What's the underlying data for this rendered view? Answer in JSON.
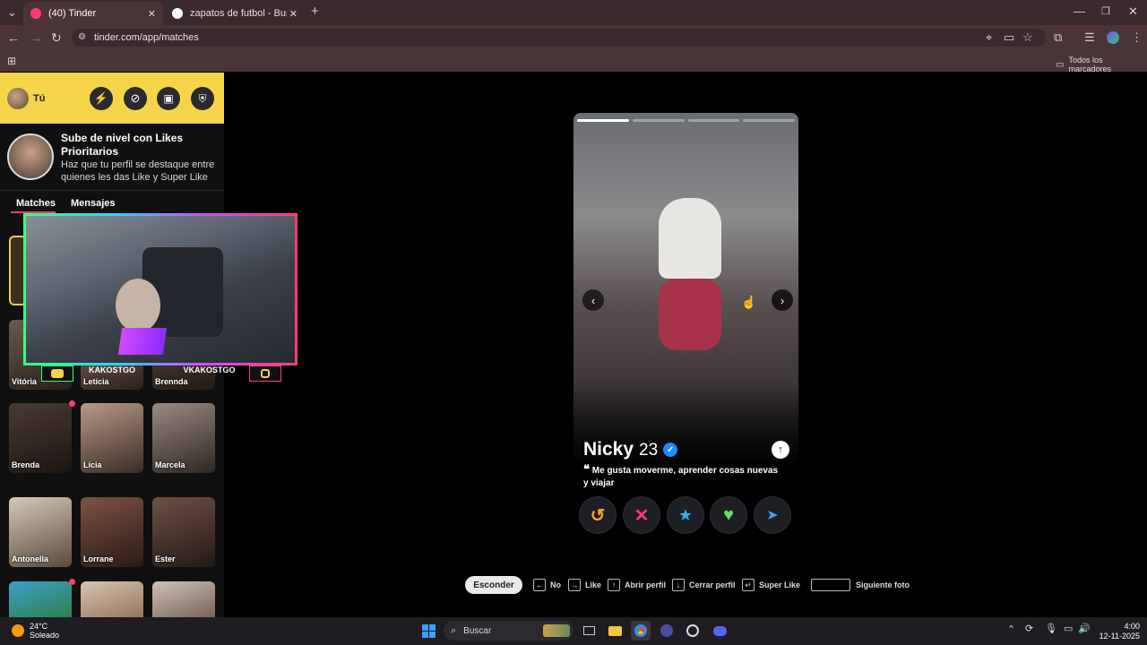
{
  "browser": {
    "tabs": [
      {
        "title": "(40) Tinder",
        "active": true,
        "favicon_color": "#fe3c72"
      },
      {
        "title": "zapatos de futbol - Buscar con",
        "active": false,
        "favicon_color": "#ffffff"
      }
    ],
    "url": "tinder.com/app/matches",
    "bookmarks_label": "Todos los marcadores"
  },
  "sidebar": {
    "profile_label": "Tú",
    "promo": {
      "title": "Sube de nivel con Likes Prioritarios",
      "subtitle": "Haz que tu perfil se destaque entre quienes les das Like y Super Like"
    },
    "tabs": {
      "matches": "Matches",
      "messages": "Mensajes"
    },
    "matches_row1": [
      "Vitória",
      "Letícia",
      "Brennda"
    ],
    "matches_row2": [
      "Brenda",
      "Lícia",
      "Marcela"
    ],
    "matches_row3": [
      "Antonella",
      "Lorrane",
      "Ester"
    ]
  },
  "stream_overlay": {
    "left_name": "KAKOSTGO",
    "right_name": "VKAKOSTGO"
  },
  "profile_card": {
    "name": "Nicky",
    "age": "23",
    "bio": "Me gusta moverme, aprender cosas nuevas y viajar",
    "verified": true,
    "photo_count": 4,
    "current_photo": 1
  },
  "action_buttons": [
    {
      "id": "rewind",
      "color": "#f6a623"
    },
    {
      "id": "nope",
      "color": "#fe3c72"
    },
    {
      "id": "super-like",
      "color": "#2db3f8"
    },
    {
      "id": "like",
      "color": "#35e0a0"
    },
    {
      "id": "boost",
      "color": "#3ea2f7"
    }
  ],
  "shortcuts": {
    "hide": "Esconder",
    "no": "No",
    "like": "Like",
    "open_profile": "Abrir perfil",
    "close_profile": "Cerrar perfil",
    "super_like": "Super Like",
    "next_photo": "Siguiente foto"
  },
  "taskbar": {
    "weather_temp": "24°C",
    "weather_desc": "Soleado",
    "search_label": "Buscar",
    "time": "4:00",
    "date": "12-11-2025"
  }
}
